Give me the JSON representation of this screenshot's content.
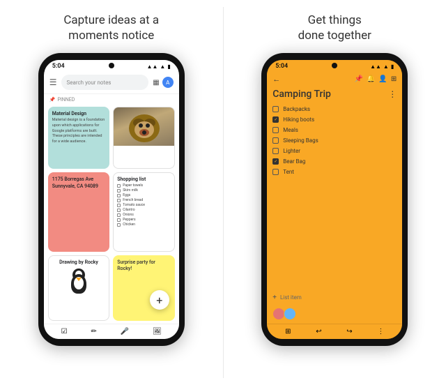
{
  "left_panel": {
    "title": "Capture ideas at a\nmoments notice",
    "phone": {
      "time": "5:04",
      "search_placeholder": "Search your notes",
      "pinned_label": "PINNED",
      "notes": [
        {
          "type": "text",
          "color": "blue",
          "title": "Material Design",
          "body": "Material design is a foundation upon which applications for Google platforms are built. These principles are intended for a wide audience."
        },
        {
          "type": "image",
          "alt": "Dog photo"
        },
        {
          "type": "address",
          "text": "1175 Borregas Ave Sunnyvale, CA 94089"
        },
        {
          "type": "shopping",
          "title": "Shopping list",
          "items": [
            "Paper towels",
            "Skim milk",
            "Eggs",
            "French bread",
            "Tomato sauce",
            "Cilantro",
            "Onions",
            "Peppers",
            "Chicken"
          ]
        },
        {
          "type": "drawing",
          "label": "Drawing by Rocky"
        },
        {
          "type": "surprise",
          "color": "yellow",
          "text": "Surprise party for Rocky!"
        }
      ]
    }
  },
  "right_panel": {
    "title": "Get things\ndone together",
    "phone": {
      "time": "5:04",
      "note_title": "Camping Trip",
      "checklist": [
        {
          "text": "Backpacks",
          "checked": false
        },
        {
          "text": "Hiking boots",
          "checked": true
        },
        {
          "text": "Meals",
          "checked": false
        },
        {
          "text": "Sleeping Bags",
          "checked": false
        },
        {
          "text": "Lighter",
          "checked": false
        },
        {
          "text": "Bear Bag",
          "checked": true
        },
        {
          "text": "Tent",
          "checked": false
        }
      ],
      "add_item_label": "List item"
    }
  }
}
